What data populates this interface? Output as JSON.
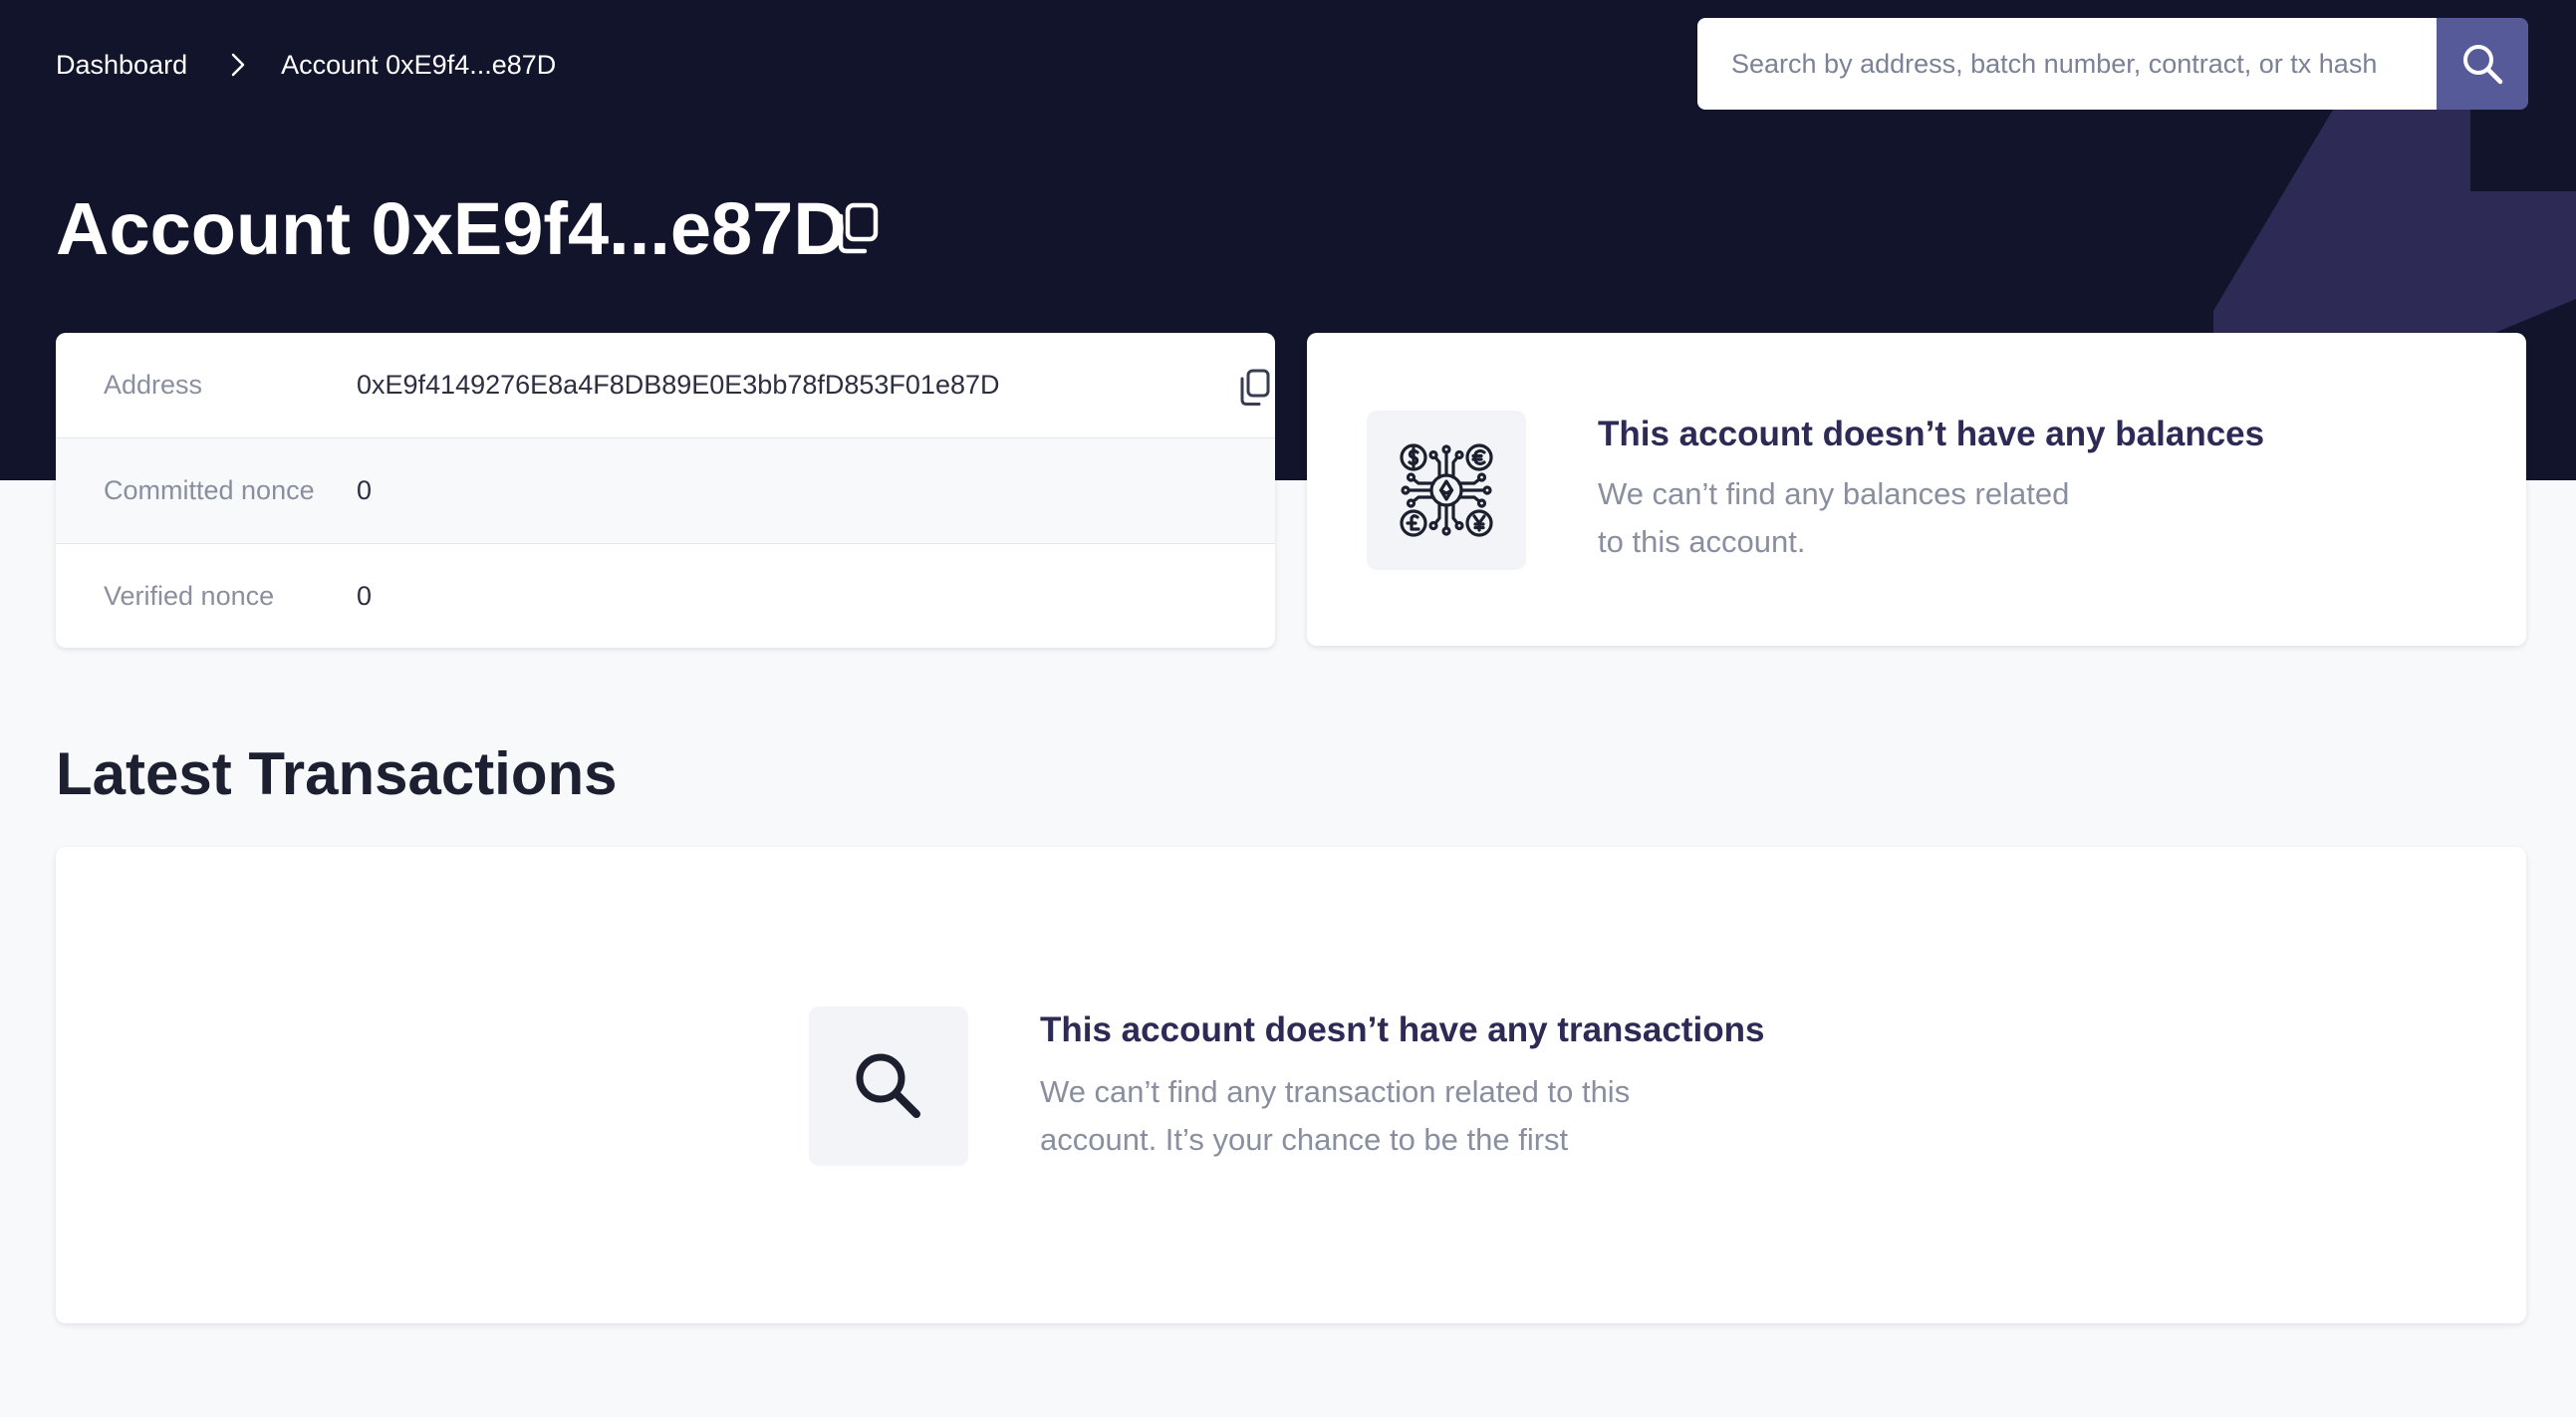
{
  "breadcrumb": {
    "root": "Dashboard",
    "current": "Account 0xE9f4...e87D"
  },
  "search": {
    "placeholder": "Search by address, batch number, contract, or tx hash",
    "icon": "search-icon"
  },
  "page": {
    "title": "Account 0xE9f4...e87D"
  },
  "account_info": {
    "rows": [
      {
        "label": "Address",
        "value": "0xE9f4149276E8a4F8DB89E0E3bb78fD853F01e87D"
      },
      {
        "label": "Committed nonce",
        "value": "0"
      },
      {
        "label": "Verified nonce",
        "value": "0"
      }
    ]
  },
  "balances": {
    "title": "This account doesn’t have any balances",
    "line1": "We can’t find any balances related",
    "line2": "to this account.",
    "icon": "currency-exchange-icon"
  },
  "transactions": {
    "section_title": "Latest Transactions",
    "empty_title": "This account doesn’t have any transactions",
    "line1": "We can’t find any transaction related to this",
    "line2": "account. It’s your chance to be the first",
    "icon": "search-icon"
  },
  "colors": {
    "header_bg": "#11142b",
    "accent": "#575a99",
    "decor": "#2d2b55",
    "page_bg": "#f8f9fb"
  }
}
